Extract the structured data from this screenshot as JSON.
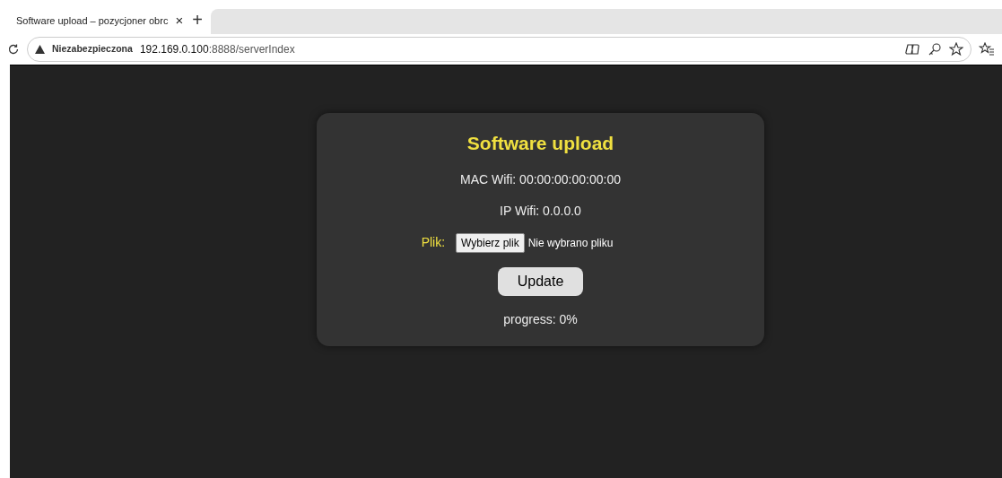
{
  "browser": {
    "tab": {
      "title": "Software upload – pozycjoner obrc",
      "close": "×",
      "selected": true
    },
    "new_tab": "+",
    "address_bar": {
      "security": "Niezabezpieczona",
      "host": "192.169.0.100",
      "path": ":8888/serverIndex"
    }
  },
  "page": {
    "title": "Software upload",
    "mac": "MAC Wifi: 00:00:00:00:00:00",
    "ip": "IP Wifi: 0.0.0.0",
    "file_label": "Plik:",
    "file_button": "Wybierz plik",
    "file_status": "Nie wybrano pliku",
    "update_button": "Update",
    "progress": "progress: 0%"
  }
}
